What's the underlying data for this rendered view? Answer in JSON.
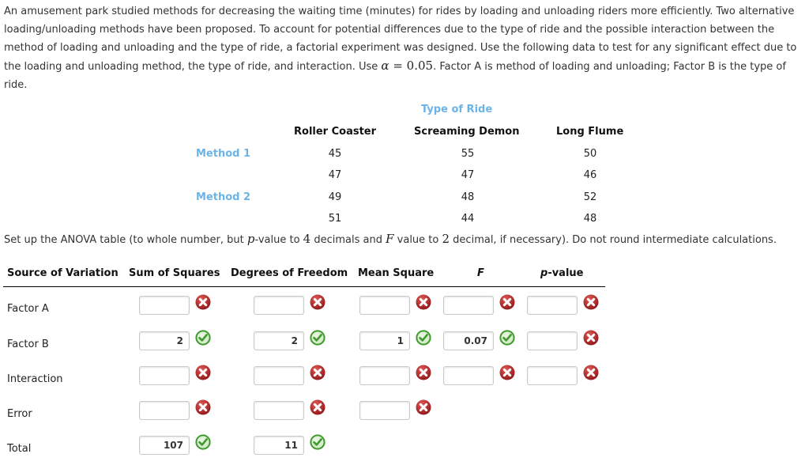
{
  "problem": {
    "text_before_alpha": "An amusement park studied methods for decreasing the waiting time (minutes) for rides by loading and unloading riders more efficiently. Two alternative loading/unloading methods have been proposed. To account for potential differences due to the type of ride and the possible interaction between the method of loading and unloading and the type of ride, a factorial experiment was designed. Use the following data to test for any significant effect due to the loading and unloading method, the type of ride, and interaction. Use ",
    "alpha_symbol": "α",
    "alpha_eq": " = 0.05",
    "text_after_alpha": ". Factor A is method of loading and unloading; Factor B is the type of ride."
  },
  "data_table": {
    "title": "Type of Ride",
    "columns": [
      "Roller Coaster",
      "Screaming Demon",
      "Long Flume"
    ],
    "rows": [
      {
        "label": "Method 1",
        "values": [
          "45",
          "55",
          "50"
        ]
      },
      {
        "label": "",
        "values": [
          "47",
          "47",
          "46"
        ]
      },
      {
        "label": "Method 2",
        "values": [
          "49",
          "48",
          "52"
        ]
      },
      {
        "label": "",
        "values": [
          "51",
          "44",
          "48"
        ]
      }
    ]
  },
  "instructions": {
    "part1": "Set up the ANOVA table (to whole number, but ",
    "p": "p",
    "part2": "-value to ",
    "four": "4",
    "part3": " decimals and ",
    "F": "F",
    "part4": " value to ",
    "two": "2",
    "part5": " decimal, if necessary). Do not round intermediate calculations."
  },
  "anova": {
    "headers": [
      "Source of Variation",
      "Sum of Squares",
      "Degrees of Freedom",
      "Mean Square",
      "F",
      "p-value"
    ],
    "rows": [
      {
        "source": "Factor A",
        "ss": "",
        "ss_status": "incorrect",
        "df": "",
        "df_status": "incorrect",
        "ms": "",
        "ms_status": "incorrect",
        "f": "",
        "f_status": "incorrect",
        "p": "",
        "p_status": "incorrect"
      },
      {
        "source": "Factor B",
        "ss": "2",
        "ss_status": "correct",
        "df": "2",
        "df_status": "correct",
        "ms": "1",
        "ms_status": "correct",
        "f": "0.07",
        "f_status": "correct",
        "p": "",
        "p_status": "incorrect"
      },
      {
        "source": "Interaction",
        "ss": "",
        "ss_status": "incorrect",
        "df": "",
        "df_status": "incorrect",
        "ms": "",
        "ms_status": "incorrect",
        "f": "",
        "f_status": "incorrect",
        "p": "",
        "p_status": "incorrect"
      },
      {
        "source": "Error",
        "ss": "",
        "ss_status": "incorrect",
        "df": "",
        "df_status": "incorrect",
        "ms": "",
        "ms_status": "incorrect"
      },
      {
        "source": "Total",
        "ss": "107",
        "ss_status": "correct",
        "df": "11",
        "df_status": "correct"
      }
    ]
  },
  "colors": {
    "accent_blue": "#6ab4e8",
    "correct_green": "#3f9a2e",
    "incorrect_red": "#b0282a"
  }
}
